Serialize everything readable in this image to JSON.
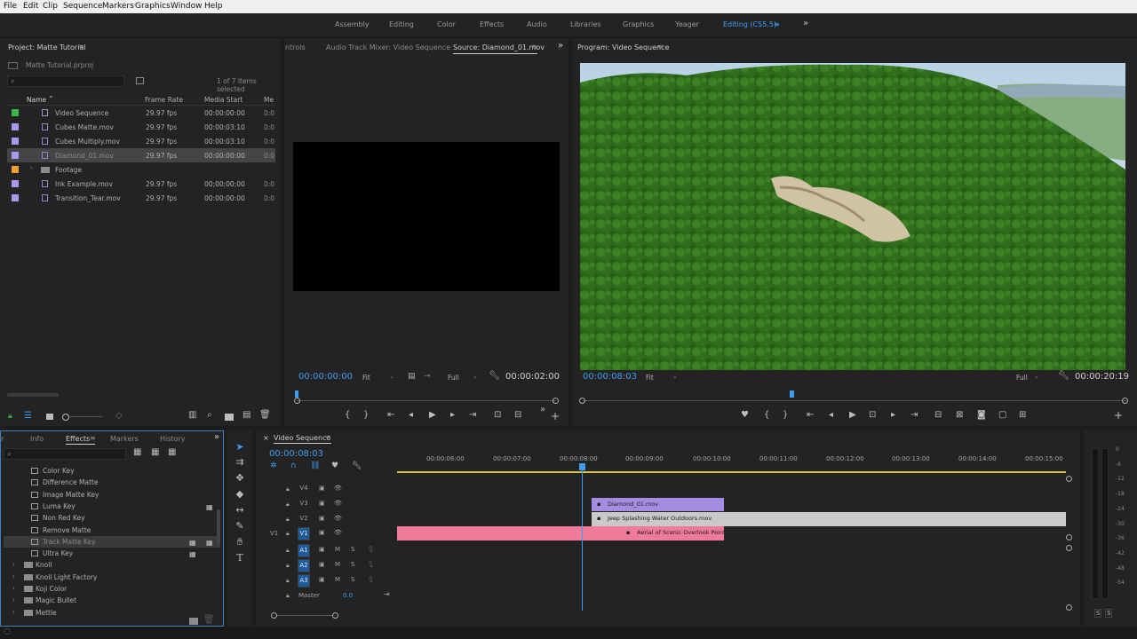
{
  "menu": [
    "File",
    "Edit",
    "Clip",
    "Sequence",
    "Markers",
    "Graphics",
    "Window",
    "Help"
  ],
  "workspaces": [
    "Assembly",
    "Editing",
    "Color",
    "Effects",
    "Audio",
    "Libraries",
    "Graphics",
    "Yeager",
    "Editing (CS5.5)"
  ],
  "workspace_active_index": 8,
  "project": {
    "title": "Project: Matte Tutorial",
    "file": "Matte Tutorial.prproj",
    "items_selected": "1 of 7 items selected",
    "columns": [
      "Name",
      "Frame Rate",
      "Media Start",
      "Me"
    ],
    "rows": [
      {
        "name": "Video Sequence",
        "fps": "29.97 fps",
        "start": "00:00:00:00",
        "color": "#3bb54a",
        "kind": "sequence"
      },
      {
        "name": "Cubes Matte.mov",
        "fps": "29.97 fps",
        "start": "00:00:03:10",
        "color": "#a79bf0",
        "kind": "clip"
      },
      {
        "name": "Cubes Multiply.mov",
        "fps": "29.97 fps",
        "start": "00:00:03:10",
        "color": "#a79bf0",
        "kind": "clip"
      },
      {
        "name": "Diamond_01.mov",
        "fps": "29.97 fps",
        "start": "00:00:00:00",
        "color": "#a79bf0",
        "kind": "clip",
        "selected": true
      },
      {
        "name": "Footage",
        "fps": "",
        "start": "",
        "color": "#f0a030",
        "kind": "bin"
      },
      {
        "name": "Ink Example.mov",
        "fps": "29.97 fps",
        "start": "00;00;00;00",
        "color": "#a79bf0",
        "kind": "clip"
      },
      {
        "name": "Transition_Tear.mov",
        "fps": "29.97 fps",
        "start": "00:00:00:00",
        "color": "#a79bf0",
        "kind": "clip"
      }
    ]
  },
  "source": {
    "tabs": [
      "ntrols",
      "Audio Track Mixer: Video Sequence",
      "Source: Diamond_01.mov"
    ],
    "timecode": "00:00:00:00",
    "fit": "Fit",
    "quality": "Full",
    "duration": "00:00:02:00"
  },
  "program": {
    "title": "Program: Video Sequence",
    "timecode": "00:00:08:03",
    "fit": "Fit",
    "quality": "Full",
    "duration": "00:00:20:19"
  },
  "effects": {
    "tabs": [
      "r",
      "Info",
      "Effects",
      "Markers",
      "History"
    ],
    "active_tab": "Effects",
    "items": [
      {
        "name": "Color Key",
        "type": "effect"
      },
      {
        "name": "Difference Matte",
        "type": "effect"
      },
      {
        "name": "Image Matte Key",
        "type": "effect"
      },
      {
        "name": "Luma Key",
        "type": "effect"
      },
      {
        "name": "Non Red Key",
        "type": "effect"
      },
      {
        "name": "Remove Matte",
        "type": "effect"
      },
      {
        "name": "Track Matte Key",
        "type": "effect",
        "selected": true
      },
      {
        "name": "Ultra Key",
        "type": "effect"
      },
      {
        "name": "Knoll",
        "type": "folder"
      },
      {
        "name": "Knoll Light Factory",
        "type": "folder"
      },
      {
        "name": "Koji Color",
        "type": "folder"
      },
      {
        "name": "Magic Bullet",
        "type": "folder"
      },
      {
        "name": "Mettle",
        "type": "folder"
      }
    ]
  },
  "timeline": {
    "title": "Video Sequence",
    "timecode": "00:00:08:03",
    "ruler": [
      "00:00:06:00",
      "00:00:07:00",
      "00:00:08:00",
      "00:00:09:00",
      "00:00:10:00",
      "00:00:11:00",
      "00:00:12:00",
      "00:00:13:00",
      "00:00:14:00",
      "00:00:15:00"
    ],
    "video_tracks": [
      "V4",
      "V3",
      "V2",
      "V1"
    ],
    "audio_tracks": [
      "A1",
      "A2",
      "A3"
    ],
    "source_patch": "V1",
    "master_label": "Master",
    "master_value": "0.0",
    "mute_label": "M",
    "solo_label": "S",
    "clips": [
      {
        "track": "V3",
        "name": "Diamond_01.mov",
        "color": "#a48de0"
      },
      {
        "track": "V2",
        "name": "Jeep Splashing Water Outdoors.mov",
        "color": "#c9c9c9"
      },
      {
        "track": "V1",
        "name": "Aerial of Scenic Overlook Point.mov",
        "color": "#f07a9a"
      }
    ]
  },
  "meter": {
    "scale": [
      "0",
      "-6",
      "-12",
      "-18",
      "-24",
      "-30",
      "-36",
      "-42",
      "-48",
      "-54"
    ],
    "solo_labels": [
      "S",
      "S"
    ]
  },
  "colors": {
    "accent": "#3f9cf0",
    "panel": "#232323",
    "background": "#1d1d1d"
  }
}
